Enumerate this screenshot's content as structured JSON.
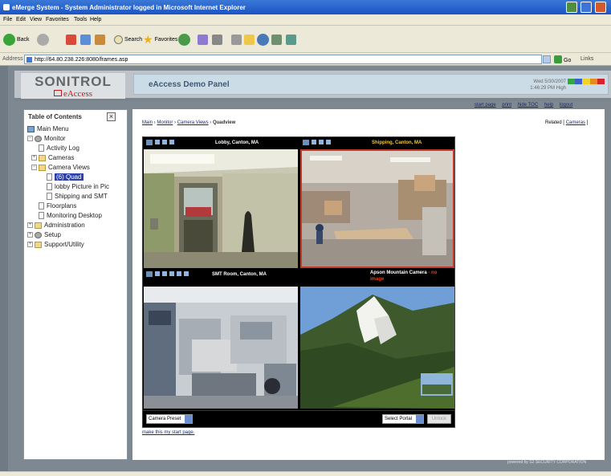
{
  "window": {
    "title": "eMerge System - System Administrator logged in      Microsoft Internet Explorer"
  },
  "menu": [
    "File",
    "Edit",
    "View",
    "Favorites",
    "Tools",
    "Help"
  ],
  "toolbar": {
    "back": "Back",
    "search": "Search",
    "favorites": "Favorites"
  },
  "address": {
    "label": "Address",
    "url": "http://64.80.238.226:8080/frames.asp",
    "go": "Go",
    "links": "Links"
  },
  "header": {
    "logo_main": "SONITROL",
    "logo_sub": "eAccess",
    "panel_title": "eAccess Demo Panel",
    "date": "Wed 5/30/2007",
    "time": "1:46:29 PM",
    "level": "High"
  },
  "toplinks": [
    "start page",
    "print",
    "hide TOC",
    "help",
    "logout"
  ],
  "toc": {
    "title": "Table of Contents",
    "items": [
      "Main Menu",
      "Monitor",
      "Activity Log",
      "Cameras",
      "Camera Views",
      "(6) Quad",
      "lobby Picture in Pic",
      "Shipping and SMT",
      "Floorplans",
      "Monitoring Desktop",
      "Administration",
      "Setup",
      "Support/Utility"
    ]
  },
  "breadcrumb": {
    "items": [
      "Main",
      "Monitor",
      "Camera Views"
    ],
    "current": "Quadview"
  },
  "related": {
    "label": "Related [",
    "link": "Cameras",
    "end": "]"
  },
  "cameras": [
    {
      "name": "Lobby, Canton, MA"
    },
    {
      "name": "Shipping, Canton, MA"
    },
    {
      "name": "SMT Room, Canton, MA"
    },
    {
      "name": "Apson Mountain Camera",
      "note_line1": "- no",
      "note_line2": "image"
    }
  ],
  "quad_controls": {
    "preset": "Camera Preset",
    "portal": "Select Portal",
    "unlock": "Unlock"
  },
  "make_start": "make this my start page.",
  "powered": "powered by S2 SECURITY CORPORATION",
  "colors": {
    "selected": "#2a3fa8",
    "panel_title": "#3d5a78",
    "camera_label_yellow": "#f2c83a",
    "camera_label_red": "#e0421c",
    "link": "#1a2a6c"
  }
}
